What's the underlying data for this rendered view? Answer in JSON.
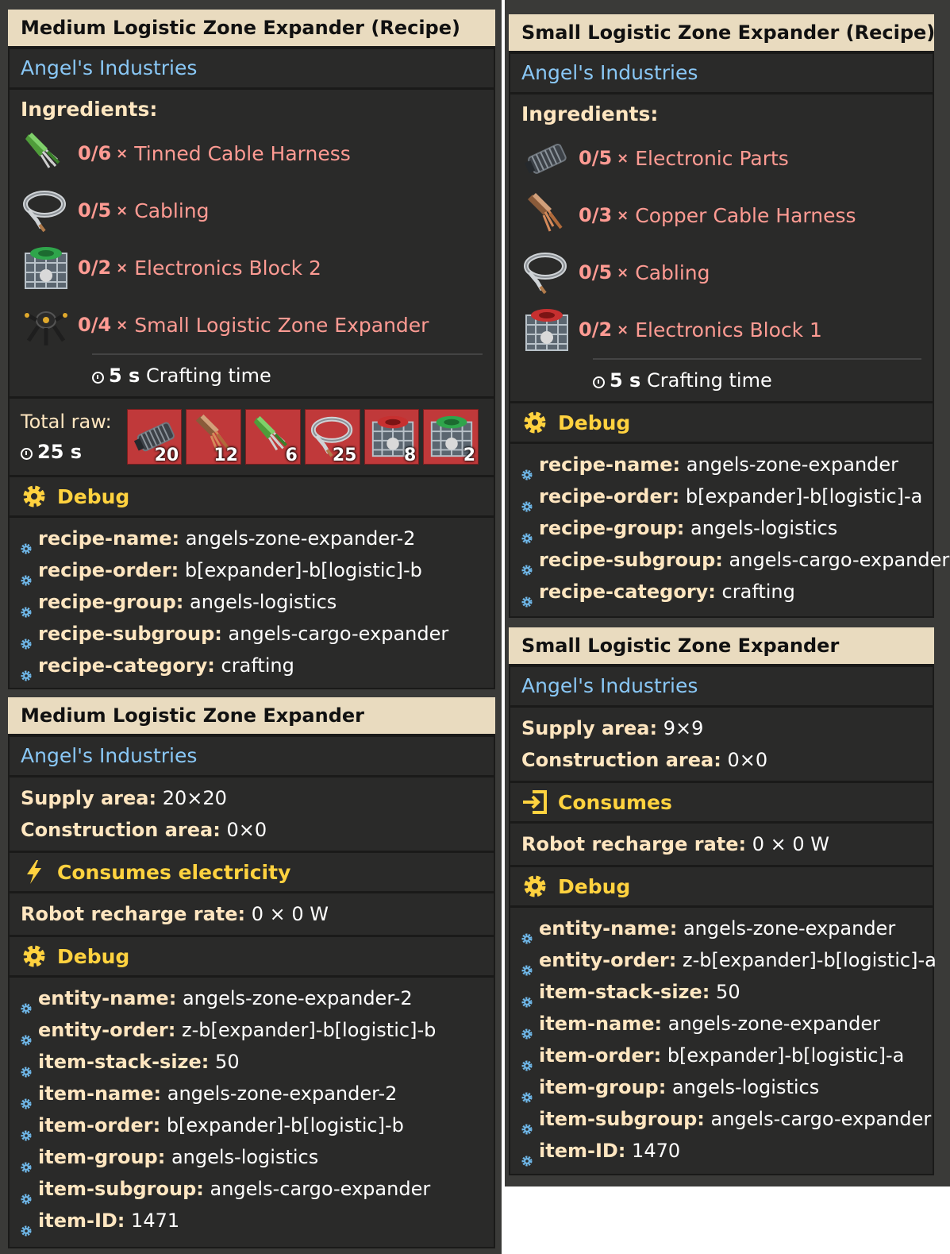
{
  "left_recipe": {
    "title": "Medium Logistic Zone Expander (Recipe)",
    "source": "Angel's Industries",
    "ingredients_label": "Ingredients:",
    "ingredients": [
      {
        "count": "0/6",
        "times": "×",
        "name": "Tinned Cable Harness",
        "icon": "tinned-cable-harness-icon"
      },
      {
        "count": "0/5",
        "times": "×",
        "name": "Cabling",
        "icon": "cabling-icon"
      },
      {
        "count": "0/2",
        "times": "×",
        "name": "Electronics Block 2",
        "icon": "electronics-block-2-icon"
      },
      {
        "count": "0/4",
        "times": "×",
        "name": "Small Logistic Zone Expander",
        "icon": "small-zone-expander-icon"
      }
    ],
    "craft_time": "5 s",
    "craft_label": "Crafting time",
    "total_raw_label": "Total raw:",
    "total_raw_time": "25 s",
    "raw": [
      {
        "icon": "electronic-parts-icon",
        "count": "20"
      },
      {
        "icon": "copper-cable-harness-icon",
        "count": "12"
      },
      {
        "icon": "tinned-cable-harness-icon",
        "count": "6"
      },
      {
        "icon": "cabling-icon",
        "count": "25"
      },
      {
        "icon": "electronics-block-1-icon",
        "count": "8"
      },
      {
        "icon": "electronics-block-2-icon",
        "count": "2"
      }
    ],
    "debug_label": "Debug",
    "debug": [
      {
        "k": "recipe-name:",
        "v": "angels-zone-expander-2"
      },
      {
        "k": "recipe-order:",
        "v": "b[expander]-b[logistic]-b"
      },
      {
        "k": "recipe-group:",
        "v": "angels-logistics"
      },
      {
        "k": "recipe-subgroup:",
        "v": "angels-cargo-expander"
      },
      {
        "k": "recipe-category:",
        "v": "crafting"
      }
    ]
  },
  "left_entity": {
    "title": "Medium Logistic Zone Expander",
    "source": "Angel's Industries",
    "props": [
      {
        "k": "Supply area:",
        "v": "20×20"
      },
      {
        "k": "Construction area:",
        "v": "0×0"
      }
    ],
    "consumes_label": "Consumes electricity",
    "recharge": {
      "k": "Robot recharge rate:",
      "v": "0 × 0 W"
    },
    "debug_label": "Debug",
    "debug": [
      {
        "k": "entity-name:",
        "v": "angels-zone-expander-2"
      },
      {
        "k": "entity-order:",
        "v": "z-b[expander]-b[logistic]-b"
      },
      {
        "k": "item-stack-size:",
        "v": "50"
      },
      {
        "k": "item-name:",
        "v": "angels-zone-expander-2"
      },
      {
        "k": "item-order:",
        "v": "b[expander]-b[logistic]-b"
      },
      {
        "k": "item-group:",
        "v": "angels-logistics"
      },
      {
        "k": "item-subgroup:",
        "v": "angels-cargo-expander"
      },
      {
        "k": "item-ID:",
        "v": "1471"
      }
    ]
  },
  "right_recipe": {
    "title": "Small Logistic Zone Expander (Recipe)",
    "source": "Angel's Industries",
    "ingredients_label": "Ingredients:",
    "ingredients": [
      {
        "count": "0/5",
        "times": "×",
        "name": "Electronic Parts",
        "icon": "electronic-parts-icon"
      },
      {
        "count": "0/3",
        "times": "×",
        "name": "Copper Cable Harness",
        "icon": "copper-cable-harness-icon"
      },
      {
        "count": "0/5",
        "times": "×",
        "name": "Cabling",
        "icon": "cabling-icon"
      },
      {
        "count": "0/2",
        "times": "×",
        "name": "Electronics Block 1",
        "icon": "electronics-block-1-icon"
      }
    ],
    "craft_time": "5 s",
    "craft_label": "Crafting time",
    "debug_label": "Debug",
    "debug": [
      {
        "k": "recipe-name:",
        "v": "angels-zone-expander"
      },
      {
        "k": "recipe-order:",
        "v": "b[expander]-b[logistic]-a"
      },
      {
        "k": "recipe-group:",
        "v": "angels-logistics"
      },
      {
        "k": "recipe-subgroup:",
        "v": "angels-cargo-expander"
      },
      {
        "k": "recipe-category:",
        "v": "crafting"
      }
    ]
  },
  "right_entity": {
    "title": "Small Logistic Zone Expander",
    "source": "Angel's Industries",
    "props": [
      {
        "k": "Supply area:",
        "v": "9×9"
      },
      {
        "k": "Construction area:",
        "v": "0×0"
      }
    ],
    "consumes_label": "Consumes",
    "recharge": {
      "k": "Robot recharge rate:",
      "v": "0 × 0 W"
    },
    "debug_label": "Debug",
    "debug": [
      {
        "k": "entity-name:",
        "v": "angels-zone-expander"
      },
      {
        "k": "entity-order:",
        "v": "z-b[expander]-b[logistic]-a"
      },
      {
        "k": "item-stack-size:",
        "v": "50"
      },
      {
        "k": "item-name:",
        "v": "angels-zone-expander"
      },
      {
        "k": "item-order:",
        "v": "b[expander]-b[logistic]-a"
      },
      {
        "k": "item-group:",
        "v": "angels-logistics"
      },
      {
        "k": "item-subgroup:",
        "v": "angels-cargo-expander"
      },
      {
        "k": "item-ID:",
        "v": "1470"
      }
    ]
  },
  "colors": {
    "title_bg": "#e9dbbf",
    "panel_bg": "#2a2a29",
    "source_link": "#89c7f5",
    "heading": "#ffe6c0",
    "missing_ingredient": "#ff9b93",
    "debug_heading": "#ffd23f",
    "raw_slot": "#c0393a"
  }
}
